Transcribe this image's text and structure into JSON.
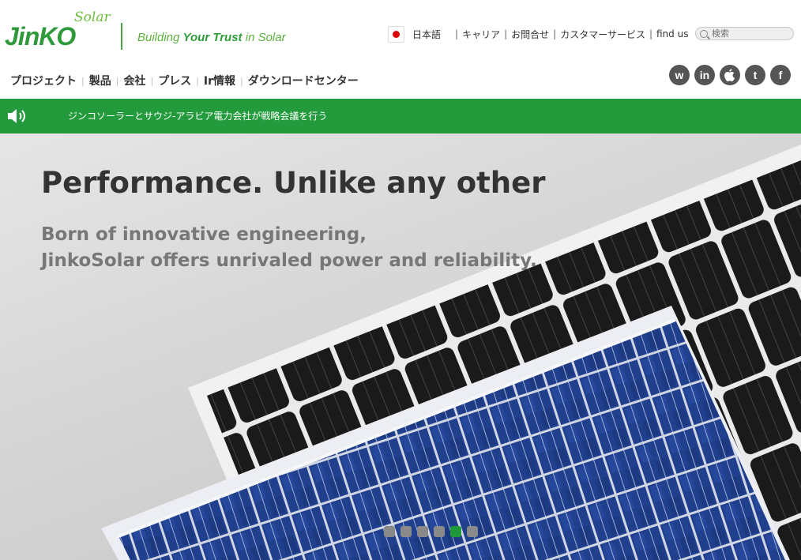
{
  "brand": {
    "logo_text": "JinKO",
    "logo_sub": "Solar",
    "tagline_pre": "Building ",
    "tagline_bold": "Your Trust",
    "tagline_post": " in Solar",
    "accent": "#2e9a3b"
  },
  "topnav": {
    "language": "日本語",
    "links": [
      "キャリア",
      "お問合せ",
      "カスタマーサービス",
      "find us"
    ],
    "search_placeholder": "検索"
  },
  "mainnav": [
    "プロジェクト",
    "製品",
    "会社",
    "プレス",
    "Ir情報",
    "ダウンロードセンター"
  ],
  "social": [
    {
      "name": "weibo-icon",
      "glyph": "w"
    },
    {
      "name": "linkedin-icon",
      "glyph": "in"
    },
    {
      "name": "apple-icon",
      "glyph": ""
    },
    {
      "name": "twitter-icon",
      "glyph": "t"
    },
    {
      "name": "facebook-icon",
      "glyph": "f"
    }
  ],
  "ticker": {
    "icon": "speaker-icon",
    "text": "ジンコソーラーとサウジ-アラビア電力会社が戦略会議を行う"
  },
  "hero": {
    "title": "Performance. Unlike any other",
    "subtitle_line1": "Born of innovative engineering,",
    "subtitle_line2": "JinkoSolar offers unrivaled power and reliability.",
    "slides": 6,
    "active_slide": 5
  }
}
